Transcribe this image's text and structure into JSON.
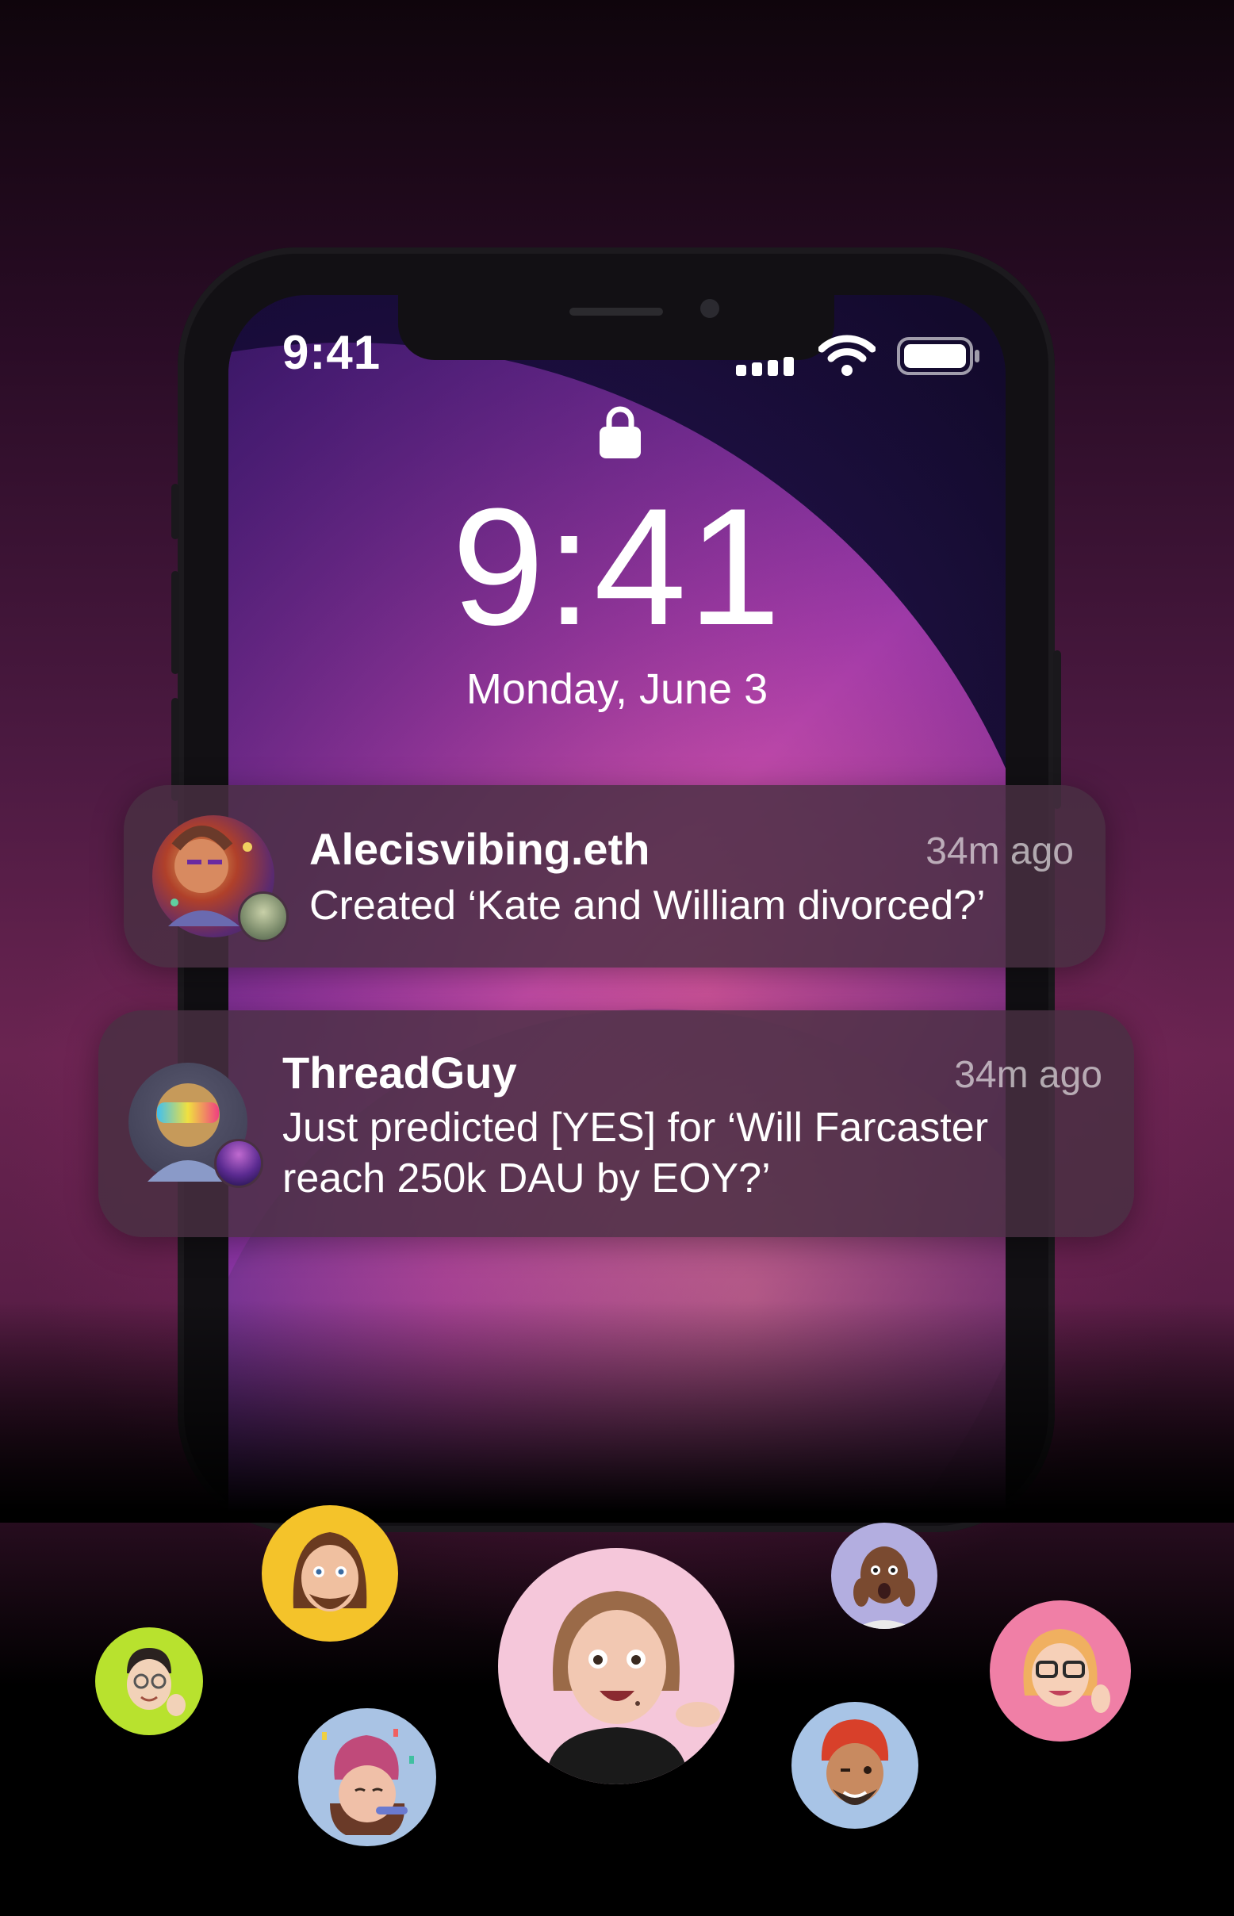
{
  "status_bar": {
    "time": "9:41",
    "icons": [
      "cellular-signal-icon",
      "wifi-icon",
      "battery-icon"
    ]
  },
  "lock_screen": {
    "lock_icon": "lock-icon",
    "time": "9:41",
    "date": "Monday, June 3"
  },
  "notifications": [
    {
      "title": "Alecisvibing.eth",
      "time": "34m ago",
      "body": "Created ‘Kate and William divorced?’"
    },
    {
      "title": "ThreadGuy",
      "time": "34m ago",
      "body_line1": "Just predicted [YES] for ‘Will Farcaster",
      "body_line2": "reach 250k DAU by EOY?’"
    }
  ],
  "memojis": [
    {
      "name": "memoji-yellow",
      "bg": "#f4c32a"
    },
    {
      "name": "memoji-green",
      "bg": "#b8e22e"
    },
    {
      "name": "memoji-blue-party",
      "bg": "#a9c3e4"
    },
    {
      "name": "memoji-pink-center",
      "bg": "#f5c7da"
    },
    {
      "name": "memoji-lavender",
      "bg": "#b3aee0"
    },
    {
      "name": "memoji-blue-turban",
      "bg": "#a8c4e6"
    },
    {
      "name": "memoji-pink-glasses",
      "bg": "#f07fa6"
    }
  ]
}
